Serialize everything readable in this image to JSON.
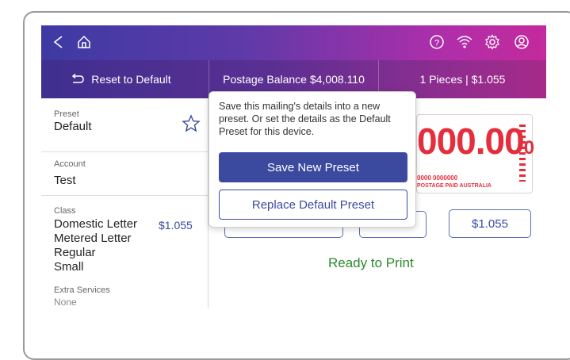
{
  "topbar": {
    "icons": [
      "back-icon",
      "home-icon",
      "help-icon",
      "wifi-icon",
      "settings-icon",
      "account-icon"
    ]
  },
  "subbar": {
    "reset_label": "Reset to Default",
    "postage_balance": "Postage Balance $4,008.110",
    "pieces": "1 Pieces | $1.055"
  },
  "sidebar": {
    "preset_label": "Preset",
    "preset_value": "Default",
    "account_label": "Account",
    "account_value": "Test",
    "class_label": "Class",
    "class_lines": [
      "Domestic Letter",
      "Metered Letter",
      "Regular",
      "Small"
    ],
    "class_price": "$1.055",
    "extra_label": "Extra Services",
    "extra_value": "None"
  },
  "popover": {
    "message": "Save this mailing's details into a new preset. Or set the details as the Default Preset for this device.",
    "save_new": "Save New Preset",
    "replace_default": "Replace Default Preset"
  },
  "stamp": {
    "amount": "000.00",
    "amount_suffix": "0",
    "codes": "0000     0000000",
    "footer": "POSTAGE PAID AUSTRALIA",
    "color": "#e52d3c"
  },
  "main": {
    "price_button": "$1.055",
    "status": "Ready to Print"
  }
}
